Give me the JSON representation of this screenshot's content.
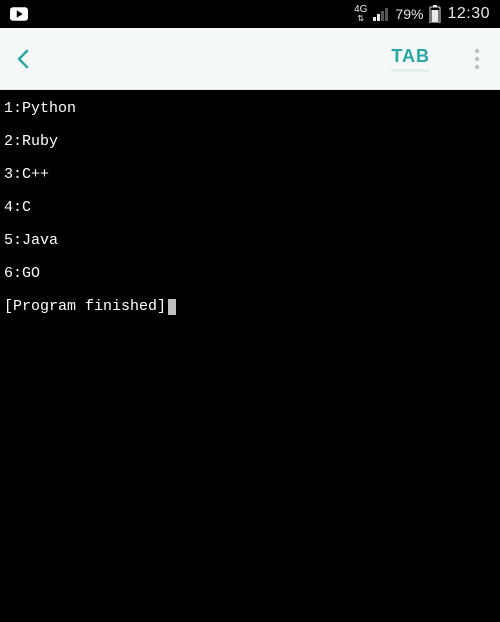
{
  "status": {
    "network": "4G",
    "battery_pct": "79%",
    "time": "12:30"
  },
  "appbar": {
    "tab_label": "TAB"
  },
  "terminal": {
    "lines": [
      "1:Python",
      "2:Ruby",
      "3:C++",
      "4:C",
      "5:Java",
      "6:GO"
    ],
    "finished": "[Program finished]"
  }
}
